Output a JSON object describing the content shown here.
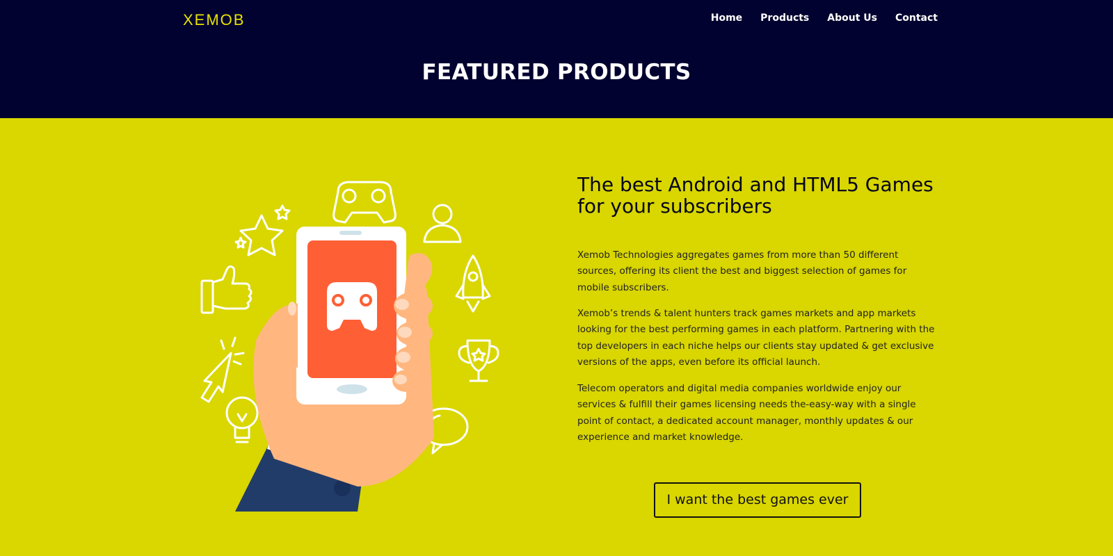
{
  "brand": {
    "logo_text": "XEMOB"
  },
  "nav": {
    "items": [
      {
        "label": "Home"
      },
      {
        "label": "Products"
      },
      {
        "label": "About Us"
      },
      {
        "label": "Contact"
      }
    ]
  },
  "hero": {
    "title": "FEATURED PRODUCTS"
  },
  "content": {
    "headline": "The best Android and HTML5 Games for your subscribers",
    "paragraphs": [
      "Xemob Technologies aggregates games from more than 50 different sources, offering its client the best and biggest selection of games for mobile subscribers.",
      "Xemob’s trends & talent hunters track games markets and app markets looking for the best performing games in each platform. Partnering with the top developers in each niche helps our clients stay updated & get exclusive versions of the apps, even before its official launch.",
      "Telecom operators and digital media companies worldwide enjoy our services & fulfill their games licensing needs the-easy-way with a single point of contact, a dedicated account manager, monthly updates & our experience and market knowledge."
    ],
    "cta_label": "I want the best games ever"
  },
  "colors": {
    "header_bg": "#020230",
    "main_bg": "#d9d600",
    "logo": "#e6e200",
    "phone_screen": "#ff5f35",
    "hand": "#ffb77f",
    "sleeve": "#223c6a"
  },
  "icons": [
    "gamepad-icon",
    "stars-icon",
    "user-icon",
    "thumbs-up-icon",
    "rocket-icon",
    "cursor-click-icon",
    "trophy-icon",
    "lightbulb-icon",
    "speech-bubble-icon",
    "smartphone-icon"
  ]
}
